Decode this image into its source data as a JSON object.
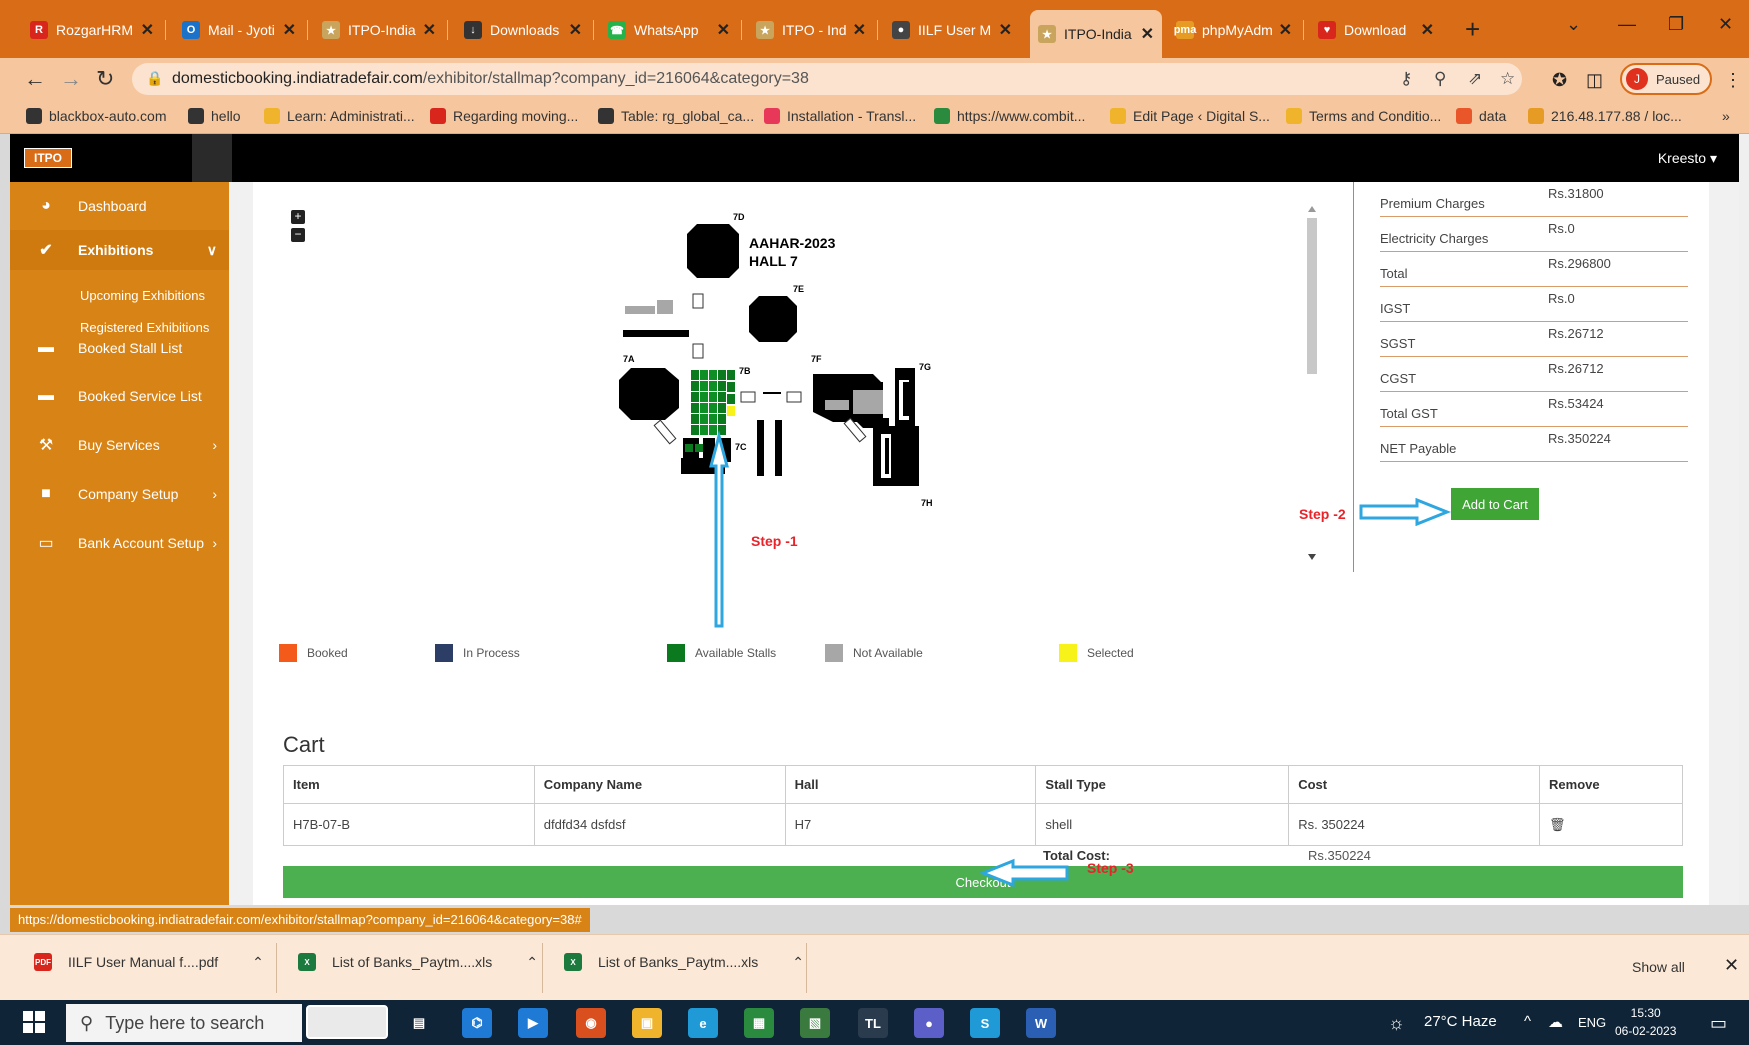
{
  "browser": {
    "tabs": [
      {
        "title": "RozgarHRM",
        "fav_color": "#d9261c",
        "fav_glyph": "R"
      },
      {
        "title": "Mail - Jyoti",
        "fav_color": "#1a73c9",
        "fav_glyph": "O"
      },
      {
        "title": "ITPO-India",
        "fav_color": "#c9a45c",
        "fav_glyph": "★"
      },
      {
        "title": "Downloads",
        "fav_color": "#333333",
        "fav_glyph": "↓"
      },
      {
        "title": "WhatsApp",
        "fav_color": "#25b24a",
        "fav_glyph": "☎"
      },
      {
        "title": "ITPO - India",
        "fav_color": "#c9a45c",
        "fav_glyph": "★"
      },
      {
        "title": "IILF User M",
        "fav_color": "#444444",
        "fav_glyph": "●"
      },
      {
        "title": "ITPO-India",
        "fav_color": "#c9a45c",
        "fav_glyph": "★"
      },
      {
        "title": "phpMyAdm",
        "fav_color": "#e69c24",
        "fav_glyph": "pma"
      },
      {
        "title": "Download",
        "fav_color": "#d9261c",
        "fav_glyph": "♥"
      }
    ],
    "address": {
      "domain": "domesticbooking.indiatradefair.com",
      "path": "/exhibitor/stallmap?company_id=216064&category=38"
    },
    "profile_status": "Paused",
    "profile_initial": "J",
    "bookmarks": [
      {
        "label": "blackbox-auto.com",
        "color": "#333333"
      },
      {
        "label": "hello",
        "color": "#333333"
      },
      {
        "label": "Learn: Administrati...",
        "color": "#f0b42c"
      },
      {
        "label": "Regarding moving...",
        "color": "#d9261c"
      },
      {
        "label": "Table: rg_global_ca...",
        "color": "#333333"
      },
      {
        "label": "Installation - Transl...",
        "color": "#e8385a"
      },
      {
        "label": "https://www.combit...",
        "color": "#2a8a3e"
      },
      {
        "label": "Edit Page ‹ Digital S...",
        "color": "#f0b42c"
      },
      {
        "label": "Terms and Conditio...",
        "color": "#f0b42c"
      },
      {
        "label": "data",
        "color": "#e8562a"
      },
      {
        "label": "216.48.177.88 / loc...",
        "color": "#e69c24"
      }
    ],
    "bookmarks_more": "»"
  },
  "app": {
    "logo": "ITPO",
    "user": "Kreesto ▾",
    "sidebar": {
      "items": [
        {
          "label": "Dashboard",
          "icon": "◕",
          "arrow": ""
        },
        {
          "label": "Exhibitions",
          "icon": "✔",
          "arrow": "∨"
        },
        {
          "label": "Booked Stall List",
          "icon": "▬",
          "arrow": ""
        },
        {
          "label": "Booked Service List",
          "icon": "▬",
          "arrow": ""
        },
        {
          "label": "Buy Services",
          "icon": "⚒",
          "arrow": "›"
        },
        {
          "label": "Company Setup",
          "icon": "■",
          "arrow": "›"
        },
        {
          "label": "Bank Account Setup",
          "icon": "▭",
          "arrow": "›"
        }
      ],
      "subitems": [
        "Upcoming Exhibitions",
        "Registered Exhibitions"
      ]
    },
    "map": {
      "title_line1": "AAHAR-2023",
      "title_line2": "HALL 7",
      "zoom_in": "+",
      "zoom_out": "−",
      "hall_labels": [
        "7D",
        "7E",
        "7A",
        "7B",
        "7F",
        "7G",
        "7C",
        "7H"
      ]
    },
    "fees": [
      {
        "label": "Premium Charges",
        "value": "Rs.31800"
      },
      {
        "label": "Electricity Charges",
        "value": "Rs.0"
      },
      {
        "label": "Total",
        "value": "Rs.296800"
      },
      {
        "label": "IGST",
        "value": "Rs.0"
      },
      {
        "label": "SGST",
        "value": "Rs.26712"
      },
      {
        "label": "CGST",
        "value": "Rs.26712"
      },
      {
        "label": "Total GST",
        "value": "Rs.53424"
      },
      {
        "label": "NET Payable",
        "value": "Rs.350224"
      }
    ],
    "add_to_cart": "Add to Cart",
    "steps": {
      "step1": "Step -1",
      "step2": "Step -2",
      "step3": "Step -3"
    },
    "legend": [
      {
        "label": "Booked",
        "color": "#f45a1a"
      },
      {
        "label": "In Process",
        "color": "#2c3e66"
      },
      {
        "label": "Available Stalls",
        "color": "#0b7a1e"
      },
      {
        "label": "Not Available",
        "color": "#a7a7a7"
      },
      {
        "label": "Selected",
        "color": "#f6f21a"
      }
    ],
    "cart": {
      "title": "Cart",
      "columns": [
        "Item",
        "Company Name",
        "Hall",
        "Stall Type",
        "Cost",
        "Remove"
      ],
      "rows": [
        {
          "item": "H7B-07-B",
          "company": "dfdfd34 dsfdsf",
          "hall": "H7",
          "stall_type": "shell",
          "cost": "Rs. 350224",
          "remove_icon": "🗑"
        }
      ],
      "total_label": "Total Cost:",
      "total_value": "Rs.350224",
      "checkout": "Checkout"
    },
    "status_url": "https://domesticbooking.indiatradefair.com/exhibitor/stallmap?company_id=216064&category=38#"
  },
  "downloads": {
    "items": [
      {
        "name": "IILF User Manual f....pdf",
        "color": "#d9261c",
        "glyph": "PDF"
      },
      {
        "name": "List of Banks_Paytm....xls",
        "color": "#1d7a3e",
        "glyph": "X"
      },
      {
        "name": "List of Banks_Paytm....xls",
        "color": "#1d7a3e",
        "glyph": "X"
      }
    ],
    "show_all": "Show all",
    "close": "✕"
  },
  "taskbar": {
    "search_placeholder": "Type here to search",
    "apps": [
      {
        "name": "maruti-app",
        "color": "#eaeaea",
        "glyph": ""
      },
      {
        "name": "task-view",
        "color": "#0f2437",
        "glyph": "▤"
      },
      {
        "name": "vscode",
        "color": "#1f7ad6",
        "glyph": "⌬"
      },
      {
        "name": "app-blue",
        "color": "#1f7ad6",
        "glyph": "▶"
      },
      {
        "name": "chrome",
        "color": "#d9501e",
        "glyph": "◉"
      },
      {
        "name": "file-explorer",
        "color": "#f0b42c",
        "glyph": "▣"
      },
      {
        "name": "edge",
        "color": "#1f9ad6",
        "glyph": "e"
      },
      {
        "name": "app-green",
        "color": "#2a8a3e",
        "glyph": "▦"
      },
      {
        "name": "app-multi",
        "color": "#3a7a3e",
        "glyph": "▧"
      },
      {
        "name": "app-tl",
        "color": "#2b3b4e",
        "glyph": "TL"
      },
      {
        "name": "teams",
        "color": "#5b5fc7",
        "glyph": "●"
      },
      {
        "name": "skype",
        "color": "#1f9ad6",
        "glyph": "S"
      },
      {
        "name": "word",
        "color": "#2b5fb3",
        "glyph": "W"
      }
    ],
    "weather": "27°C Haze",
    "language": "ENG",
    "time": "15:30",
    "date": "06-02-2023"
  }
}
